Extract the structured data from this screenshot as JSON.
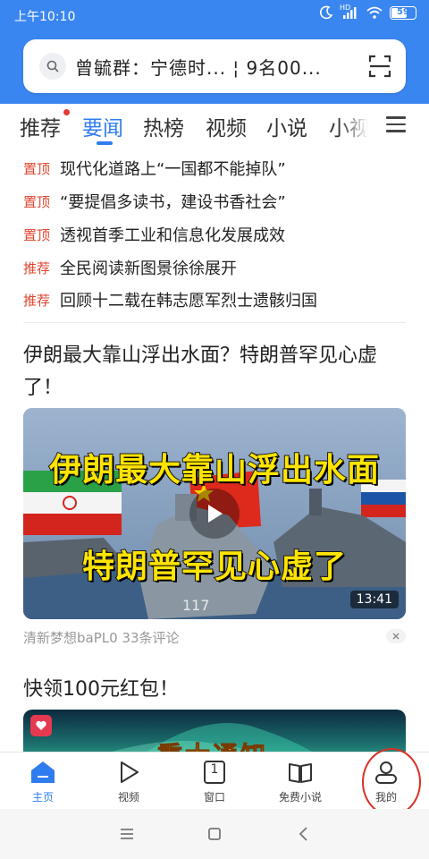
{
  "status_bar": {
    "time": "上午10:10",
    "network_label": "HD",
    "battery": "59"
  },
  "search": {
    "query": "曾毓群：宁德时... ¦ 9名00..."
  },
  "tabs": [
    {
      "label": "推荐"
    },
    {
      "label": "要闻"
    },
    {
      "label": "热榜"
    },
    {
      "label": "视频"
    },
    {
      "label": "小说"
    },
    {
      "label": "小视"
    }
  ],
  "headlines": [
    {
      "tag": "置顶",
      "title": "现代化道路上“一国都不能掉队”"
    },
    {
      "tag": "置顶",
      "title": "“要提倡多读书，建设书香社会”"
    },
    {
      "tag": "置顶",
      "title": "透视首季工业和信息化发展成效"
    },
    {
      "tag": "推荐",
      "title": "全民阅读新图景徐徐展开"
    },
    {
      "tag": "推荐",
      "title": "回顾十二载在韩志愿军烈士遗骸归国"
    }
  ],
  "article": {
    "title": "伊朗最大靠山浮出水面？特朗普罕见心虚了！",
    "video_caption_line1": "伊朗最大靠山浮出水面",
    "video_caption_line2": "特朗普罕见心虚了",
    "ship_number": "117",
    "duration": "13:41",
    "meta": "清新梦想baPL0 33条评论"
  },
  "promo": {
    "title": "快领100元红包！",
    "banner_text": "重大通知"
  },
  "bottom_nav": [
    {
      "label": "主页",
      "icon": "home-icon"
    },
    {
      "label": "视频",
      "icon": "play-icon"
    },
    {
      "label": "窗口",
      "icon": "window-icon",
      "badge": "1"
    },
    {
      "label": "免费小说",
      "icon": "book-icon"
    },
    {
      "label": "我的",
      "icon": "profile-icon"
    }
  ],
  "colors": {
    "header_blue": "#3a86f0",
    "accent_blue": "#2f7cf0",
    "tag_red": "#e0462f",
    "highlight_red": "#d93025"
  }
}
